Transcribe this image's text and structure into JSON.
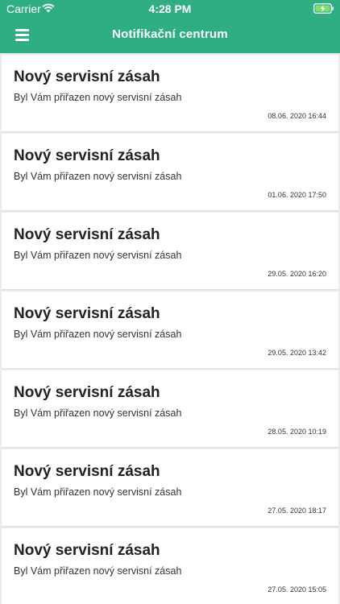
{
  "status": {
    "carrier": "Carrier",
    "time": "4:28 PM"
  },
  "header": {
    "title": "Notifikační centrum"
  },
  "colors": {
    "accent": "#2fad83",
    "card_bg": "#ffffff",
    "list_bg": "#ececec"
  },
  "notifications": [
    {
      "title": "Nový servisní zásah",
      "text": "Byl Vám přiřazen nový servisní zásah",
      "date": "08.06. 2020 16:44"
    },
    {
      "title": "Nový servisní zásah",
      "text": "Byl Vám přiřazen nový servisní zásah",
      "date": "01.06. 2020 17:50"
    },
    {
      "title": "Nový servisní zásah",
      "text": "Byl Vám přiřazen nový servisní zásah",
      "date": "29.05. 2020 16:20"
    },
    {
      "title": "Nový servisní zásah",
      "text": "Byl Vám přiřazen nový servisní zásah",
      "date": "29.05. 2020 13:42"
    },
    {
      "title": "Nový servisní zásah",
      "text": "Byl Vám přiřazen nový servisní zásah",
      "date": "28.05. 2020 10:19"
    },
    {
      "title": "Nový servisní zásah",
      "text": "Byl Vám přiřazen nový servisní zásah",
      "date": "27.05. 2020 18:17"
    },
    {
      "title": "Nový servisní zásah",
      "text": "Byl Vám přiřazen nový servisní zásah",
      "date": "27.05. 2020 15:05"
    }
  ]
}
